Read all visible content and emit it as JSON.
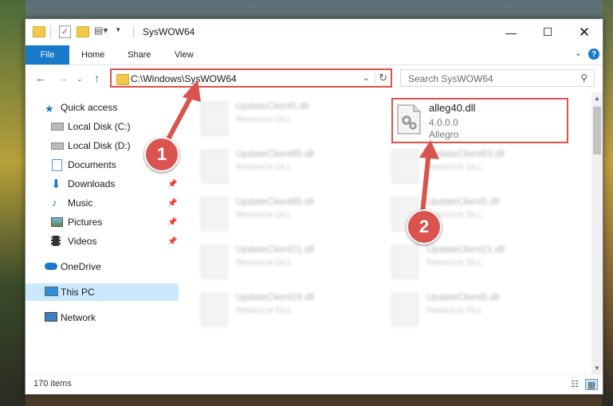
{
  "window": {
    "title": "SysWOW64"
  },
  "ribbon": {
    "file": "File",
    "home": "Home",
    "share": "Share",
    "view": "View",
    "help": "?"
  },
  "address": {
    "path": "C:\\Windows\\SysWOW64"
  },
  "search": {
    "placeholder": "Search SysWOW64"
  },
  "sidebar": {
    "quick_access": "Quick access",
    "items": [
      {
        "label": "Local Disk (C:)"
      },
      {
        "label": "Local Disk (D:)"
      },
      {
        "label": "Documents"
      },
      {
        "label": "Downloads"
      },
      {
        "label": "Music"
      },
      {
        "label": "Pictures"
      },
      {
        "label": "Videos"
      }
    ],
    "onedrive": "OneDrive",
    "thispc": "This PC",
    "network": "Network"
  },
  "files": [
    {
      "name": "UpdateClient5.dll",
      "type": "Resource DLL"
    },
    {
      "name": "UpdateClient65.dll",
      "type": "Resource DLL"
    },
    {
      "name": "UpdateClient63.dll",
      "type": "Resource DLL"
    },
    {
      "name": "UpdateClient65.dll",
      "type": "Resource DLL"
    },
    {
      "name": "UpdateClient5.dll",
      "type": "Resource DLL"
    },
    {
      "name": "UpdateClient21.dll",
      "type": "Resource DLL"
    },
    {
      "name": "UpdateClient21.dll",
      "type": "Resource DLL"
    },
    {
      "name": "UpdateClient19.dll",
      "type": "Resource DLL"
    },
    {
      "name": "UpdateClient5.dll",
      "type": "Resource DLL"
    }
  ],
  "highlighted_file": {
    "name": "alleg40.dll",
    "version": "4.0.0.0",
    "company": "Allegro"
  },
  "status": {
    "count": "170 items"
  },
  "annotations": {
    "step1": "1",
    "step2": "2",
    "color": "#d9534f"
  }
}
